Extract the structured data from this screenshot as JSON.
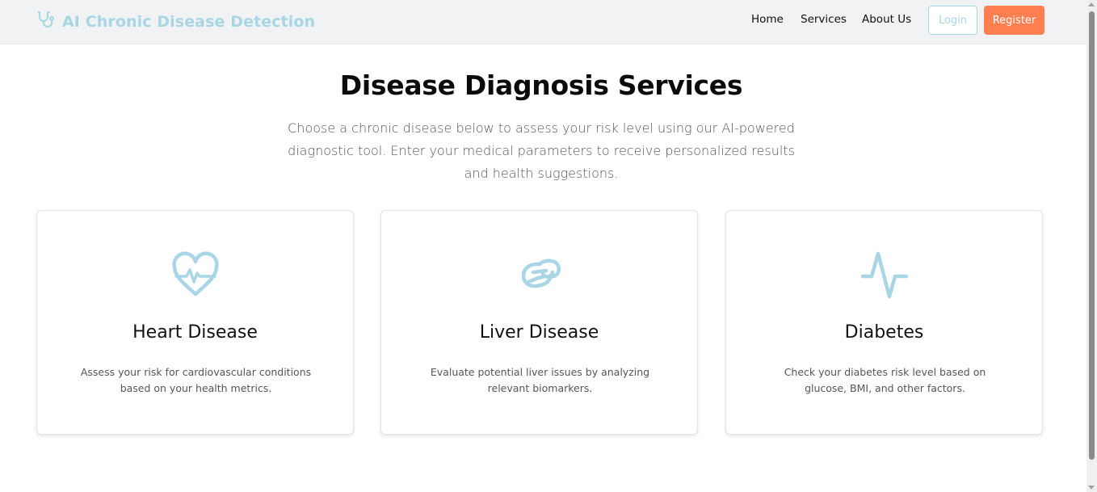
{
  "brand": {
    "title": "AI Chronic Disease Detection",
    "icon": "stethoscope-icon",
    "color": "#a9d6e5"
  },
  "nav": {
    "links": [
      "Home",
      "Services",
      "About Us"
    ],
    "login_label": "Login",
    "register_label": "Register",
    "register_color": "#ff7f50"
  },
  "hero": {
    "title": "Disease Diagnosis Services",
    "subtitle": "Choose a chronic disease below to assess your risk level using our AI-powered diagnostic tool. Enter your medical parameters to receive personalized results and health suggestions."
  },
  "cards": [
    {
      "icon": "heart-pulse-icon",
      "title": "Heart Disease",
      "description": "Assess your risk for cardiovascular conditions based on your health metrics."
    },
    {
      "icon": "liver-icon",
      "title": "Liver Disease",
      "description": "Evaluate potential liver issues by analyzing relevant biomarkers."
    },
    {
      "icon": "activity-icon",
      "title": "Diabetes",
      "description": "Check your diabetes risk level based on glucose, BMI, and other factors."
    }
  ],
  "colors": {
    "accent": "#a9d6e5",
    "navbar_bg": "#f1f2f4"
  }
}
